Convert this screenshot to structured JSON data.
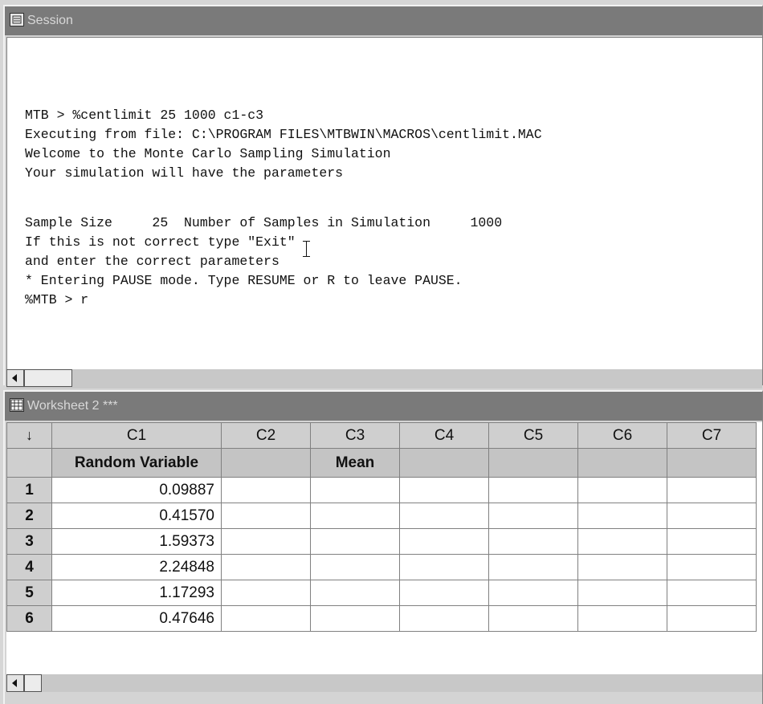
{
  "session": {
    "title": "Session",
    "lines": [
      "MTB > %centlimit 25 1000 c1-c3",
      "Executing from file: C:\\PROGRAM FILES\\MTBWIN\\MACROS\\centlimit.MAC",
      "Welcome to the Monte Carlo Sampling Simulation",
      "Your simulation will have the parameters",
      "",
      "Sample Size     25  Number of Samples in Simulation     1000",
      "If this is not correct type \"Exit\"",
      "and enter the correct parameters",
      "* Entering PAUSE mode. Type RESUME or R to leave PAUSE.",
      "%MTB > r"
    ]
  },
  "worksheet": {
    "title": "Worksheet 2 ***",
    "corner_arrow": "↓",
    "columns": [
      "C1",
      "C2",
      "C3",
      "C4",
      "C5",
      "C6",
      "C7"
    ],
    "column_names": [
      "Random Variable",
      "",
      "Mean",
      "",
      "",
      "",
      ""
    ],
    "rows": [
      {
        "num": "1",
        "c1": "0.09887"
      },
      {
        "num": "2",
        "c1": "0.41570"
      },
      {
        "num": "3",
        "c1": "1.59373"
      },
      {
        "num": "4",
        "c1": "2.24848"
      },
      {
        "num": "5",
        "c1": "1.17293"
      },
      {
        "num": "6",
        "c1": "0.47646"
      }
    ]
  },
  "icons": {
    "session_icon": "session-window-icon",
    "worksheet_icon": "worksheet-grid-icon",
    "scroll_left": "scroll-left-arrow-icon"
  },
  "colors": {
    "titlebar_inactive": "#7a7a7a",
    "header_cell": "#cfcfcf",
    "console_bg": "#ffffff"
  }
}
